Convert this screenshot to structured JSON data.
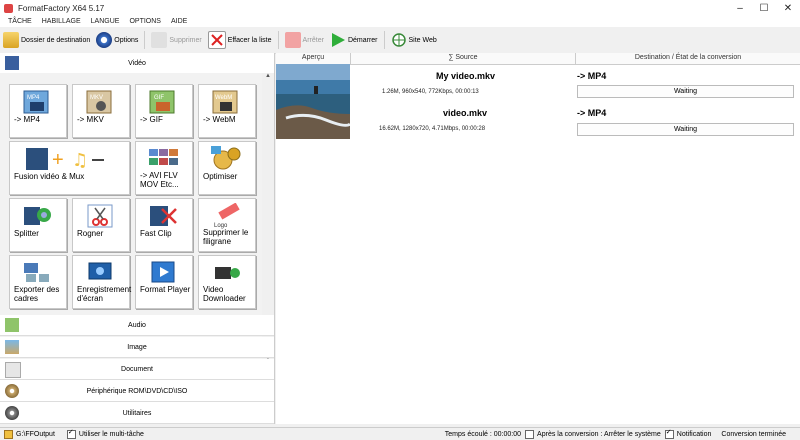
{
  "window": {
    "title": "FormatFactory X64 5.17"
  },
  "menu": [
    "TÂCHE",
    "HABILLAGE",
    "LANGUE",
    "OPTIONS",
    "AIDE"
  ],
  "toolbar": {
    "destination": "Dossier de destination",
    "options": "Options",
    "remove": "Supprimer",
    "clear": "Effacer la liste",
    "stop": "Arrêter",
    "start": "Démarrer",
    "website": "Site Web"
  },
  "left": {
    "video_header": "Vidéo",
    "tiles": [
      "-> MP4",
      "-> MKV",
      "-> GIF",
      "-> WebM",
      "Fusion vidéo & Mux",
      "-> AVI FLV MOV Etc...",
      "Optimiser",
      "Splitter",
      "Rogner",
      "Fast Clip",
      "Supprimer le filigrane",
      "Exporter des cadres",
      "Enregistrement d'écran",
      "Format Player",
      "Video Downloader"
    ],
    "tile_badges": {
      "mp4": "MP4",
      "mkv": "MKV",
      "gif": "GIF",
      "webm": "WebM",
      "logo": "Logo"
    },
    "categories": [
      "Audio",
      "Image",
      "Document",
      "Périphérique ROM\\DVD\\CD\\ISO",
      "Utilitaires"
    ]
  },
  "table": {
    "headers": [
      "Aperçu",
      "∑ Source",
      "Destination / État de la conversion"
    ],
    "rows": [
      {
        "name": "My video.mkv",
        "info": "1.26M, 960x540, 772Kbps, 00:00:13",
        "target": "-> MP4",
        "status": "Waiting"
      },
      {
        "name": "video.mkv",
        "info": "16.62M, 1280x720, 4.71Mbps, 00:00:28",
        "target": "-> MP4",
        "status": "Waiting"
      }
    ]
  },
  "statusbar": {
    "output_path": "G:\\FFOutput",
    "multi_task": "Utiliser le multi-tâche",
    "elapsed": "Temps écoulé : 00:00:00",
    "after_conversion": "Après la conversion : Arrêter le système",
    "notification": "Notification",
    "done": "Conversion terminée"
  }
}
